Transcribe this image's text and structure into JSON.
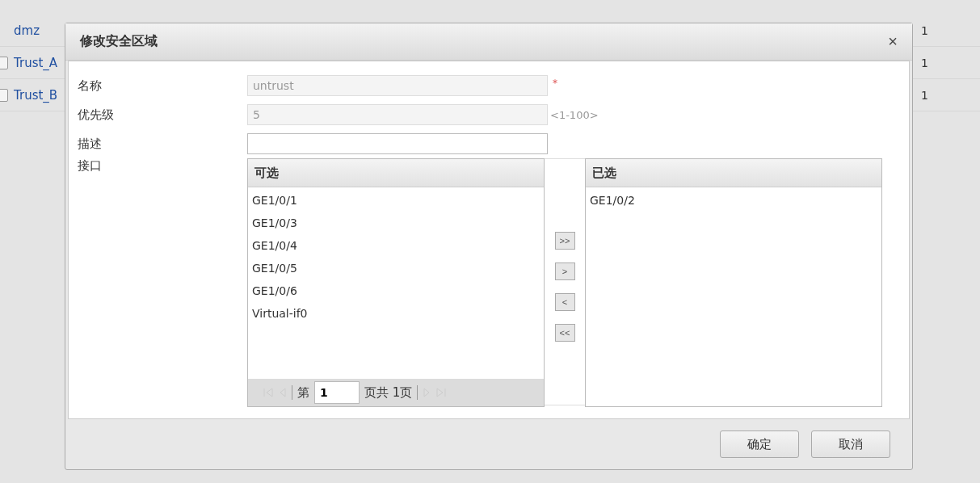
{
  "background_table": {
    "rows": [
      {
        "name": "dmz",
        "column_3": "1"
      },
      {
        "name": "Trust_A",
        "checked": false,
        "column_3": "1"
      },
      {
        "name": "Trust_B",
        "checked": false,
        "column_3": "1"
      }
    ]
  },
  "dialog": {
    "title": "修改安全区域",
    "close": "×",
    "fields": [
      {
        "label": "名称",
        "value": "untrust",
        "disabled": true,
        "required_mark": "*"
      },
      {
        "label": "优先级",
        "value": "5",
        "disabled": true,
        "range": "<1-100>"
      },
      {
        "label": "描述",
        "disabled": false
      }
    ],
    "interface": {
      "label": "接口",
      "available": {
        "header": "可选",
        "items": [
          "GE1/0/1",
          "GE1/0/3",
          "GE1/0/4",
          "GE1/0/5",
          "GE1/0/6",
          "Virtual-if0"
        ],
        "pager": {
          "prefix": "第",
          "page": "1",
          "suffix": "页共 1页"
        }
      },
      "move_buttons": [
        {
          "label": ">>"
        },
        {
          "label": ">"
        },
        {
          "label": "<"
        },
        {
          "label": "<<"
        }
      ],
      "selected": {
        "header": "已选",
        "items": [
          "GE1/0/2"
        ]
      }
    },
    "buttons": [
      {
        "label": "确定"
      },
      {
        "label": "取消"
      }
    ]
  }
}
